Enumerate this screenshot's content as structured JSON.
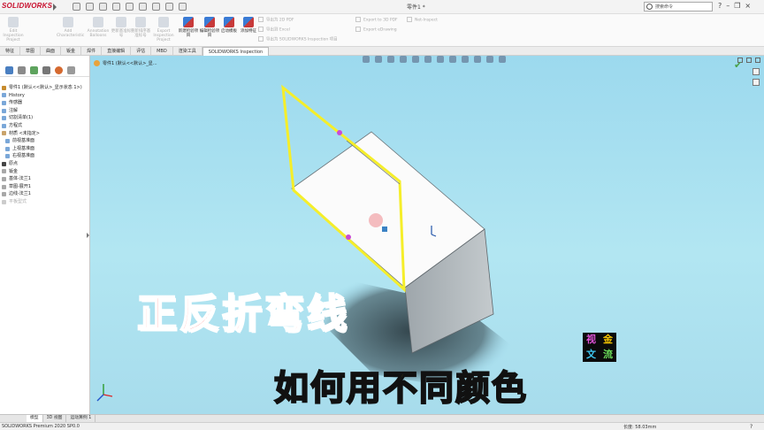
{
  "app": {
    "logo": "SOLIDWORKS",
    "doc_title": "零件1 *",
    "search_placeholder": "搜索命令",
    "window_controls": [
      "?",
      "–",
      "❐",
      "×"
    ]
  },
  "ribbon": {
    "buttons": [
      {
        "label": "Edit Inspection Project",
        "active": false
      },
      {
        "label": "Add Characteristic",
        "active": false
      },
      {
        "label": "Annotation Balloons",
        "active": false
      },
      {
        "label": "更新基准标号",
        "active": false
      },
      {
        "label": "重新排序基准标号",
        "active": false
      },
      {
        "label": "Export Inspection Project",
        "active": false
      },
      {
        "label": "新建检验项目",
        "active": true
      },
      {
        "label": "编辑检验项目",
        "active": true
      },
      {
        "label": "启动模板",
        "active": true
      },
      {
        "label": "添加特征",
        "active": true
      }
    ],
    "export_items": [
      "导出为 2D PDF",
      "导出到 Excel",
      "导出为 SOLIDWORKS Inspection 项目"
    ],
    "export_items_right": [
      "Export to 3D PDF",
      "Export eDrawing"
    ],
    "extra_items": [
      "Net-Inspect"
    ]
  },
  "tabs": [
    {
      "label": "特征",
      "active": false
    },
    {
      "label": "草图",
      "active": false
    },
    {
      "label": "曲面",
      "active": false
    },
    {
      "label": "钣金",
      "active": false
    },
    {
      "label": "焊件",
      "active": false
    },
    {
      "label": "直接编辑",
      "active": false
    },
    {
      "label": "评估",
      "active": false
    },
    {
      "label": "MBD",
      "active": false
    },
    {
      "label": "渲染工具",
      "active": false
    },
    {
      "label": "SOLIDWORKS Inspection",
      "active": true
    }
  ],
  "tree": {
    "root": "零件1 (默认<<默认>_显示状态 1>)",
    "items": [
      {
        "label": "History",
        "indent": false,
        "dim": false
      },
      {
        "label": "传感器",
        "indent": false,
        "dim": false
      },
      {
        "label": "注解",
        "indent": false,
        "dim": false
      },
      {
        "label": "切割清单(1)",
        "indent": false,
        "dim": false
      },
      {
        "label": "方程式",
        "indent": false,
        "dim": false
      },
      {
        "label": "材质 <未指定>",
        "indent": false,
        "dim": false
      },
      {
        "label": "前视基准面",
        "indent": true,
        "dim": false
      },
      {
        "label": "上视基准面",
        "indent": true,
        "dim": false
      },
      {
        "label": "右视基准面",
        "indent": true,
        "dim": false
      },
      {
        "label": "原点",
        "indent": false,
        "dim": false
      },
      {
        "label": "钣金",
        "indent": false,
        "dim": false
      },
      {
        "label": "基体-法兰1",
        "indent": false,
        "dim": false
      },
      {
        "label": "草图-展开1",
        "indent": false,
        "dim": false
      },
      {
        "label": "边线-法兰1",
        "indent": false,
        "dim": false
      },
      {
        "label": "平板型式",
        "indent": false,
        "dim": true
      }
    ]
  },
  "viewport": {
    "breadcrumb": "零件1 (默认<<默认>_显...",
    "caption_main": "正反折弯线",
    "caption_sub": "如何用不同颜色",
    "watermark_chars": [
      "视",
      "金",
      "文",
      "流"
    ]
  },
  "colors": {
    "viewport_top": "#9cd9ee",
    "selection_yellow": "#f5ee2a",
    "caption_red": "#ff2424",
    "caption_yellow": "#ffe100"
  },
  "bottom_tabs": [
    {
      "label": "模型",
      "active": true
    },
    {
      "label": "3D 视图",
      "active": false
    },
    {
      "label": "运动算例 1",
      "active": false
    }
  ],
  "status": {
    "left": "SOLIDWORKS Premium 2020 SP0.0",
    "right": "长度: 58.03mm",
    "help": "?"
  }
}
